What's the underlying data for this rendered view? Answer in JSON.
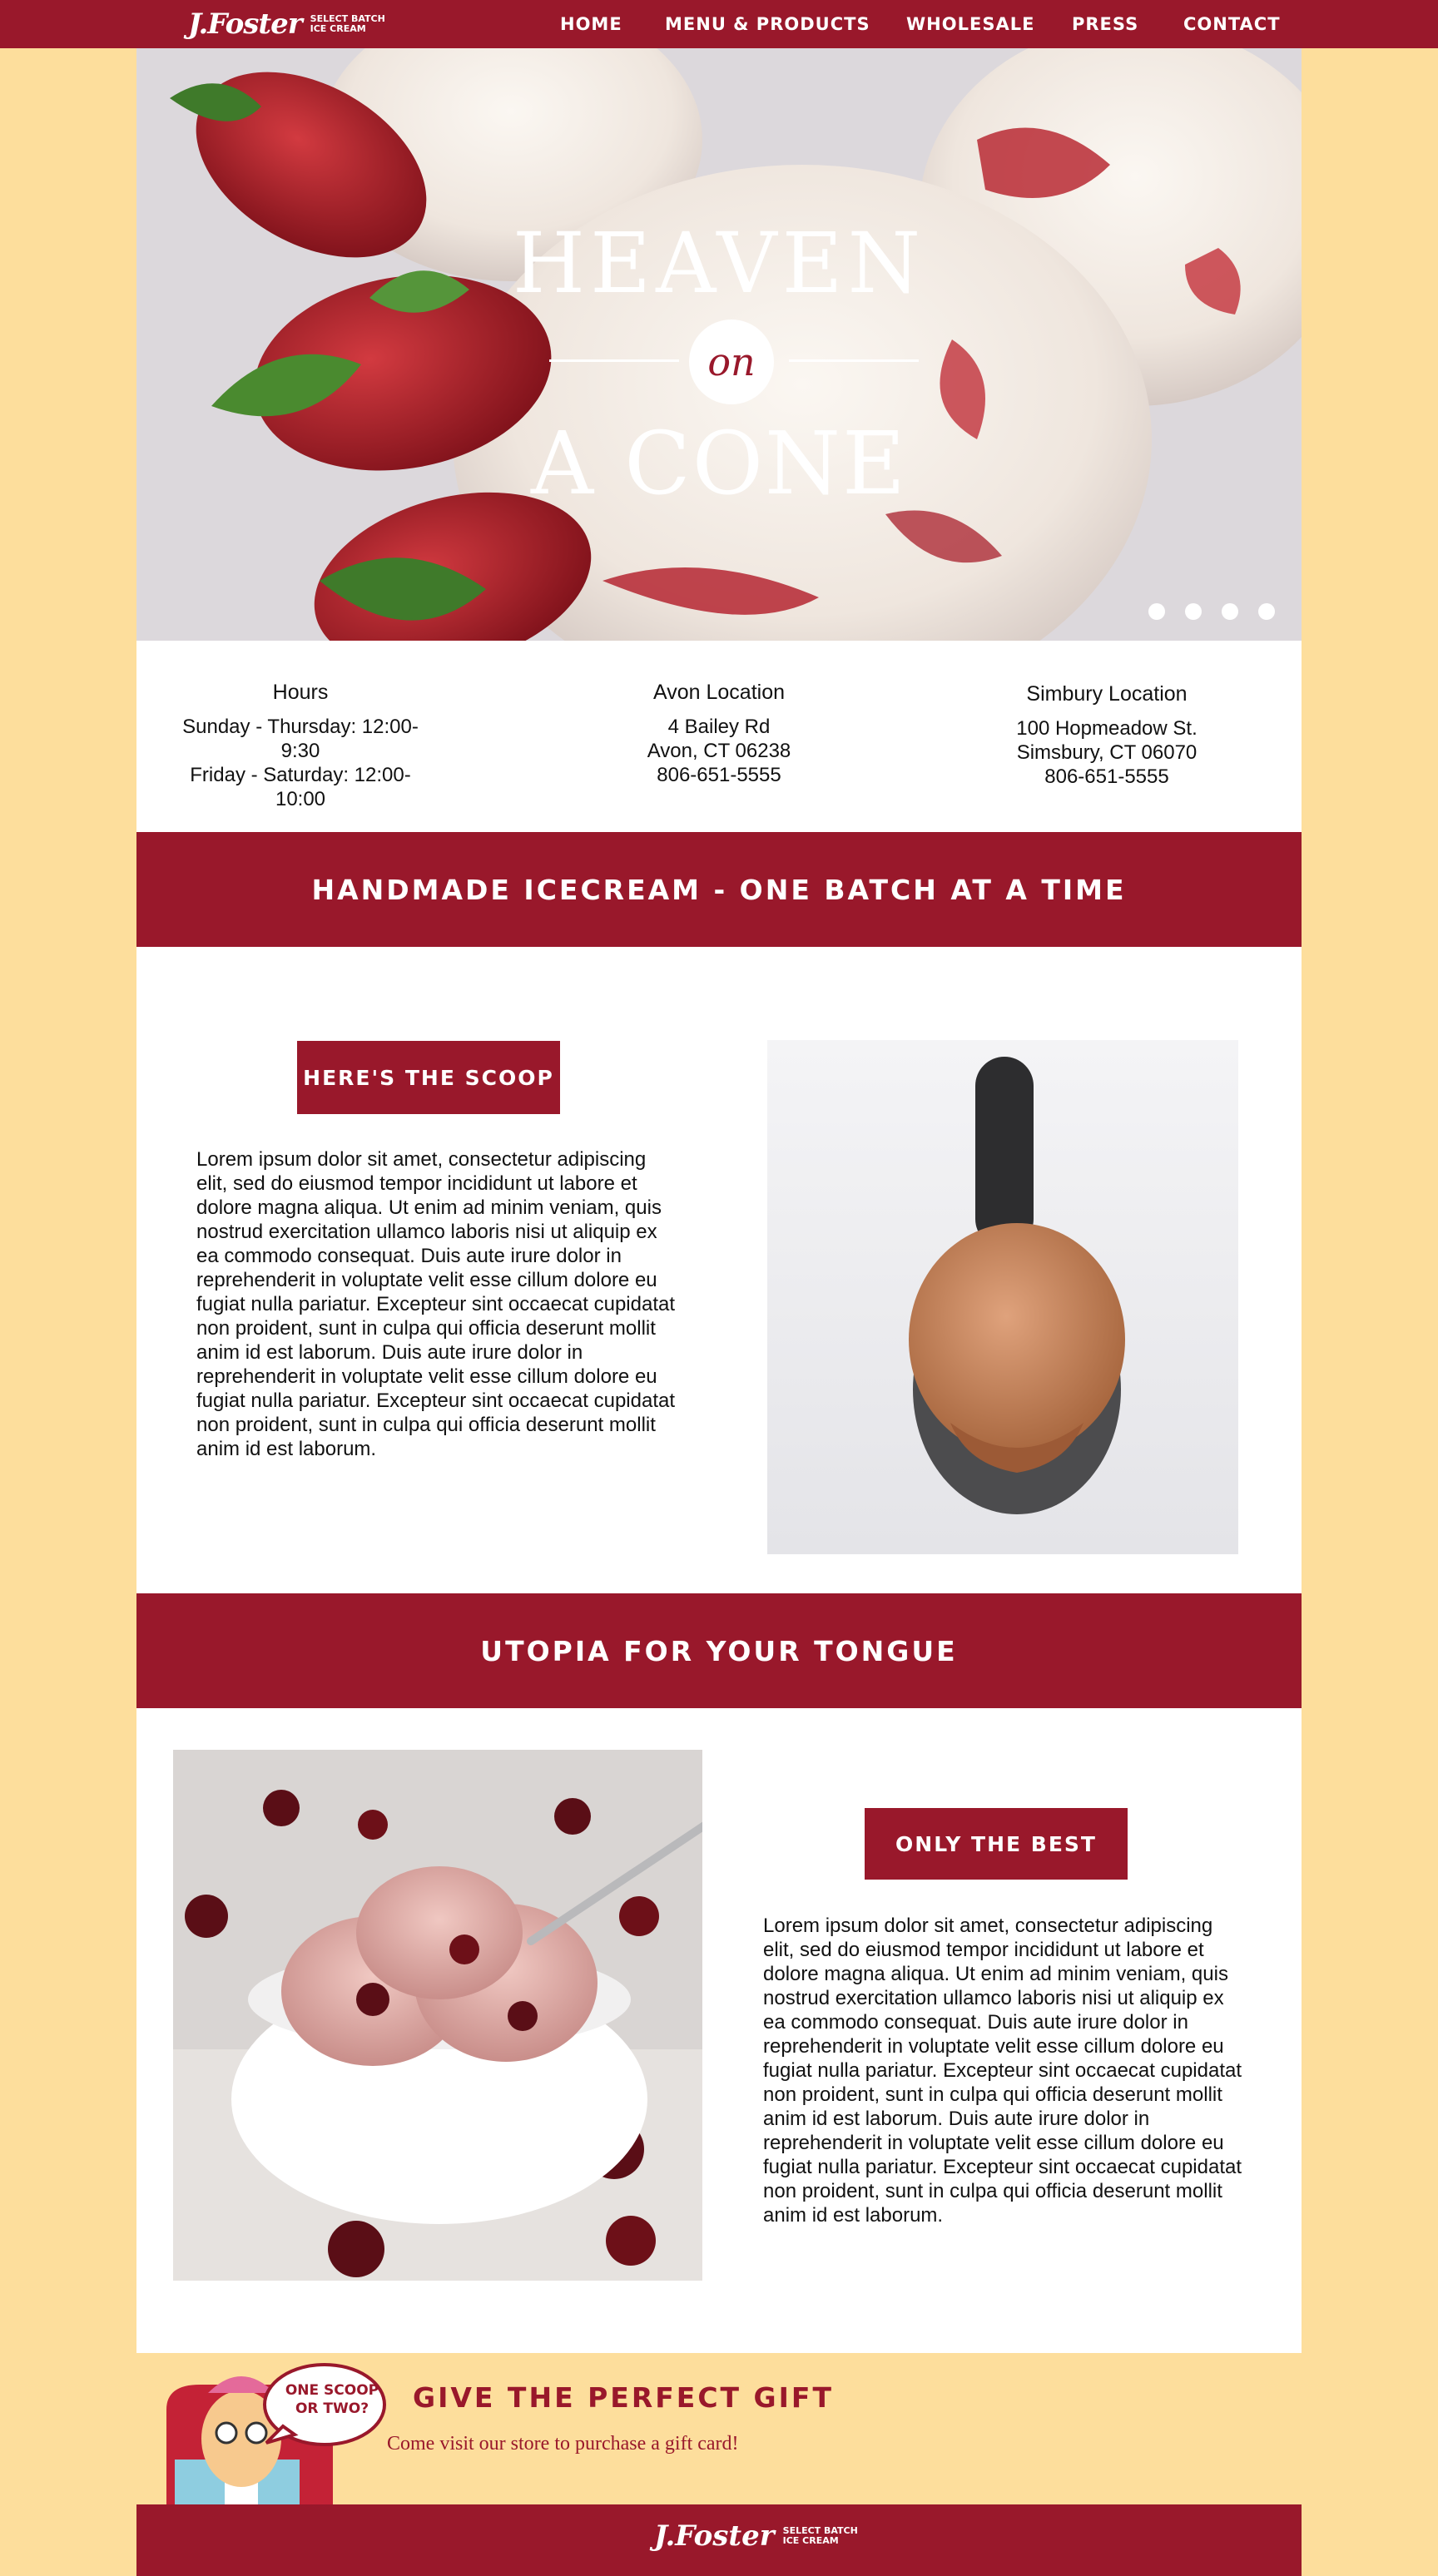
{
  "brand": {
    "logo_script": "J.Foster",
    "logo_tag_1": "SELECT BATCH",
    "logo_tag_2": "ICE CREAM"
  },
  "nav": {
    "items": [
      "HOME",
      "MENU & PRODUCTS",
      "WHOLESALE",
      "PRESS",
      "CONTACT"
    ]
  },
  "hero": {
    "line1": "HEAVEN",
    "line2": "on",
    "line3": "A CONE",
    "slides": 4
  },
  "info": {
    "hours": {
      "title": "Hours",
      "lines": [
        "Sunday - Thursday: 12:00-9:30",
        "Friday - Saturday: 12:00- 10:00"
      ]
    },
    "avon": {
      "title": "Avon Location",
      "lines": [
        "4 Bailey Rd",
        "Avon, CT 06238",
        "806-651-5555"
      ]
    },
    "simbury": {
      "title": "Simbury Location",
      "lines": [
        "100 Hopmeadow St.",
        "Simsbury, CT 06070",
        "806-651-5555"
      ]
    }
  },
  "band1": "HANDMADE ICECREAM - ONE BATCH AT A TIME",
  "scoop": {
    "label": "HERE'S THE SCOOP",
    "text": "Lorem ipsum dolor sit amet, consectetur adipiscing elit, sed do eiusmod tempor incididunt ut labore et dolore magna aliqua. Ut enim ad minim veniam, quis nostrud exercitation ullamco laboris nisi ut aliquip ex ea commodo consequat. Duis aute irure dolor in reprehenderit in voluptate velit esse cillum dolore eu fugiat nulla pariatur. Excepteur sint occaecat cupidatat non proident, sunt in culpa qui officia deserunt mollit anim id est laborum. Duis aute irure dolor in reprehenderit in voluptate velit esse cillum dolore eu fugiat nulla pariatur. Excepteur sint occaecat cupidatat non proident, sunt in culpa qui officia deserunt mollit anim id est laborum."
  },
  "band2": "UTOPIA FOR YOUR TONGUE",
  "best": {
    "label": "ONLY THE BEST",
    "text": "Lorem ipsum dolor sit amet, consectetur adipiscing elit, sed do eiusmod tempor incididunt ut labore et dolore magna aliqua. Ut enim ad minim veniam, quis nostrud exercitation ullamco laboris nisi ut aliquip ex ea commodo consequat. Duis aute irure dolor in reprehenderit in voluptate velit esse cillum dolore eu fugiat nulla pariatur. Excepteur sint occaecat cupidatat non proident, sunt in culpa qui officia deserunt mollit anim id est laborum. Duis aute irure dolor in reprehenderit in voluptate velit esse cillum dolore eu fugiat nulla pariatur. Excepteur sint occaecat cupidatat non proident, sunt in culpa qui officia deserunt mollit anim id est laborum."
  },
  "gift": {
    "title": "GIVE THE PERFECT GIFT",
    "subtitle": "Come visit our store to purchase a gift card!",
    "bubble_line1": "ONE SCOOP",
    "bubble_line2": "OR TWO?"
  },
  "colors": {
    "brand_red": "#99182b",
    "page_bg": "#fdde9c",
    "white": "#ffffff"
  }
}
